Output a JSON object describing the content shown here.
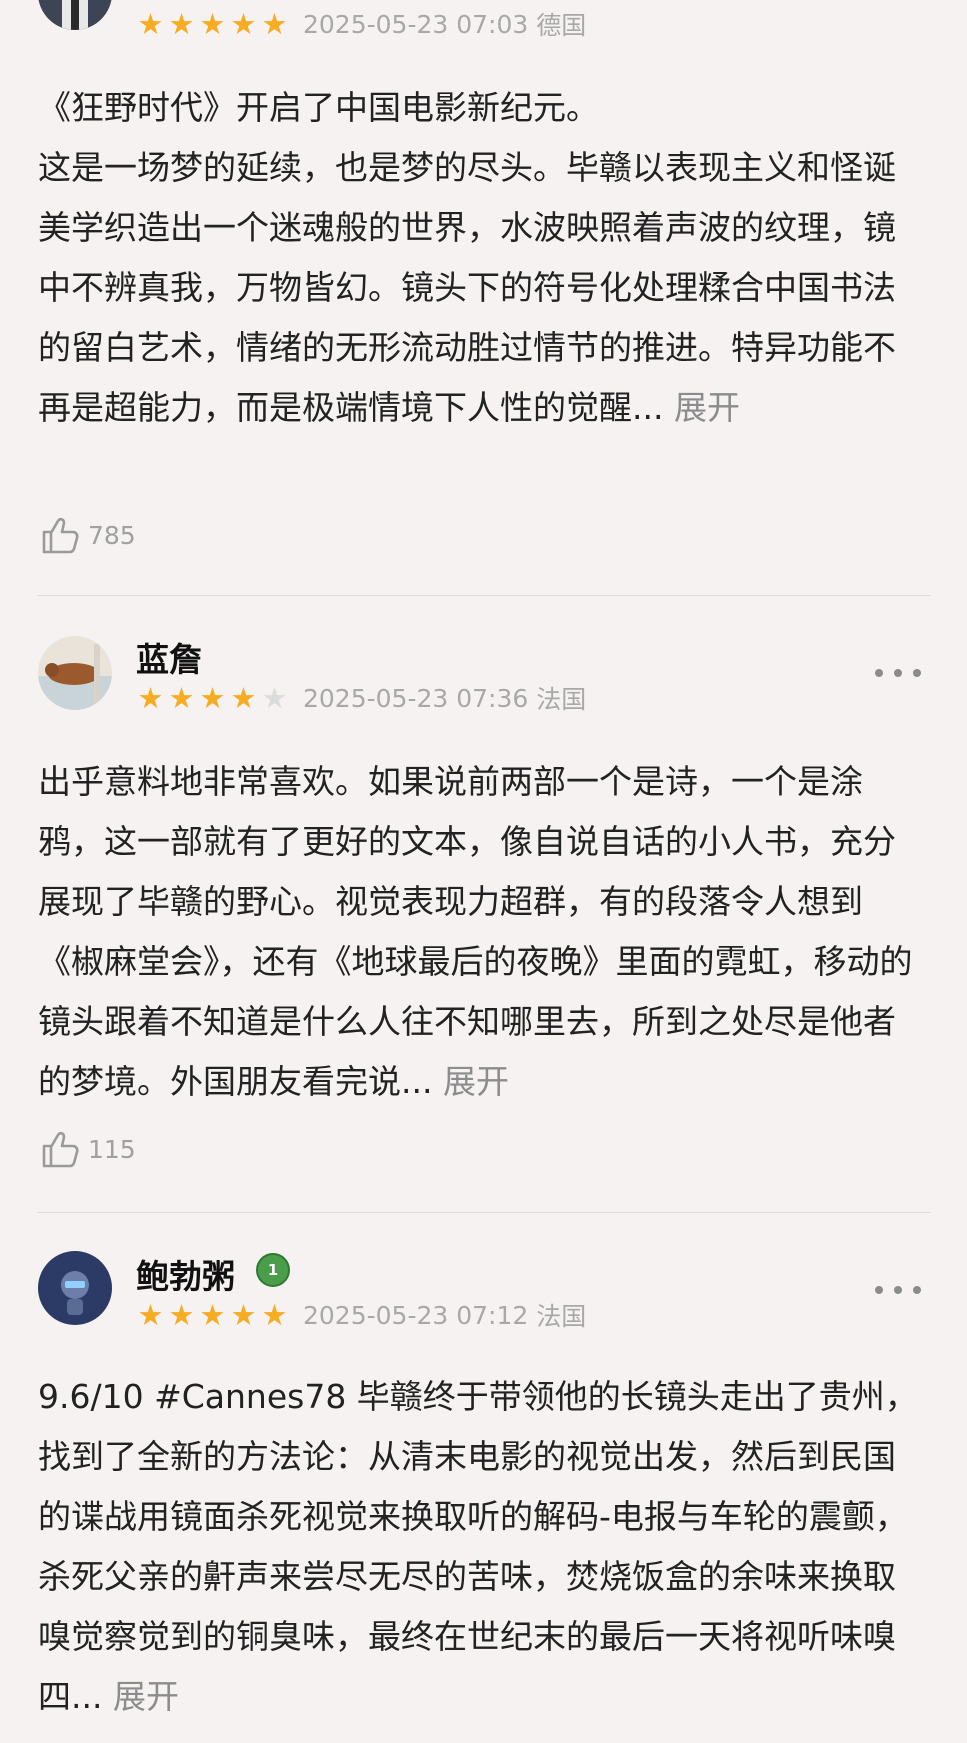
{
  "reviews": [
    {
      "username": "",
      "rating": 5,
      "time": "2025-05-23 07:03",
      "location": "德国",
      "content": "《狂野时代》开启了中国电影新纪元。\n这是一场梦的延续，也是梦的尽头。毕赣以表现主义和怪诞美学织造出一个迷魂般的世界，水波映照着声波的纹理，镜中不辨真我，万物皆幻。镜头下的符号化处理糅合中国书法的留白艺术，情绪的无形流动胜过情节的推进。特异功能不再是超能力，而是极端情境下人性的觉醒...",
      "expand": "展开",
      "likes": "785"
    },
    {
      "username": "蓝詹",
      "rating": 4,
      "time": "2025-05-23 07:36",
      "location": "法国",
      "content": "出乎意料地非常喜欢。如果说前两部一个是诗，一个是涂鸦，这一部就有了更好的文本，像自说自话的小人书，充分展现了毕赣的野心。视觉表现力超群，有的段落令人想到《椒麻堂会》，还有《地球最后的夜晚》里面的霓虹，移动的镜头跟着不知道是什么人往不知哪里去，所到之处尽是他者的梦境。外国朋友看完说...",
      "expand": "展开",
      "likes": "115"
    },
    {
      "username": "鲍勃粥",
      "badge": "1",
      "rating": 5,
      "time": "2025-05-23 07:12",
      "location": "法国",
      "content": "9.6/10 #Cannes78 毕赣终于带领他的长镜头走出了贵州，找到了全新的方法论：从清末电影的视觉出发，然后到民国的谍战用镜面杀死视觉来换取听的解码-电报与车轮的震颤，杀死父亲的鼾声来尝尽无尽的苦味，焚烧饭盒的余味来换取嗅觉察觉到的铜臭味，最终在世纪末的最后一天将视听味嗅四...",
      "expand": "展开"
    }
  ],
  "colors": {
    "star_on": "#f6ad24",
    "star_off": "#dcdcdc",
    "meta_text": "#a8a8a8",
    "expand_text": "#8c8c8c",
    "badge_green": "#4a9d4a"
  },
  "icons": {
    "like": "thumbs-up-icon",
    "more": "more-dots-icon",
    "badge": "sprout-badge-icon"
  }
}
